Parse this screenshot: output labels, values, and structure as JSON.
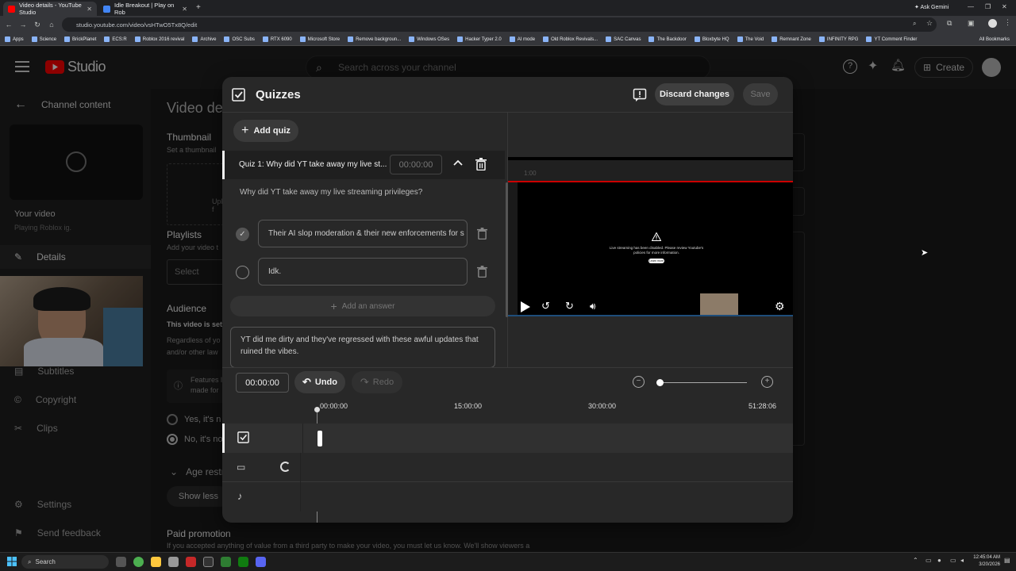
{
  "browser": {
    "tabs": [
      {
        "title": "Video details - YouTube Studio",
        "active": true
      },
      {
        "title": "Idle Breakout | Play on Rob",
        "active": false
      }
    ],
    "url": "studio.youtube.com/video/vsHTwO5Tx8Q/edit",
    "ask_label": "Ask Gemini",
    "bookmarks": [
      "Apps",
      "Science",
      "BrickPlanet",
      "ECS:R",
      "Roblox 2016 revival",
      "Archive",
      "OSC Subs",
      "RTX 6090",
      "Microsoft Store",
      "Remove backgroun...",
      "Windows OSes",
      "Hacker Typer 2.0",
      "AI mode",
      "Old Roblox Revivals...",
      "SAC Canvas",
      "The Backdoor",
      "Bloxbyte HQ",
      "The Void",
      "Remnant Zone",
      "INFINITY RPG",
      "YT Comment Finder"
    ],
    "all_bookmarks": "All Bookmarks"
  },
  "studio": {
    "logo": "Studio",
    "search_placeholder": "Search across your channel",
    "create_label": "Create"
  },
  "sidebar": {
    "back_label": "Channel content",
    "your_video": "Your video",
    "playing": "Playing Roblox ig.",
    "details": "Details",
    "items": [
      "Subtitles",
      "Copyright",
      "Clips",
      "Settings",
      "Send feedback"
    ]
  },
  "background": {
    "title": "Video de",
    "thumbnail": "Thumbnail",
    "thumbnail_sub": "Set a thumbnail",
    "upload": "Upload f",
    "playlists": "Playlists",
    "playlists_sub": "Add your video t",
    "select": "Select",
    "audience": "Audience",
    "audience_sub": "This video is set",
    "regardless": "Regardless of yo",
    "other_law": "and/or other law",
    "features": "Features l",
    "made_for": "made for",
    "yes": "Yes, it's n",
    "no": "No, it's no",
    "age": "Age restr",
    "show_less": "Show less",
    "paid": "Paid promotion",
    "paid_sub": "If you accepted anything of value from a third party to make your video, you must let us know. We'll show viewers a"
  },
  "modal": {
    "title": "Quizzes",
    "discard": "Discard changes",
    "save": "Save",
    "add_quiz": "Add quiz",
    "quiz_title": "Quiz 1: Why did YT take away my live st...",
    "quiz_time": "00:00:00",
    "question": "Why did YT take away my live streaming privileges?",
    "answers": [
      {
        "text": "Their AI slop moderation & their new enforcements for s",
        "correct": true
      },
      {
        "text": "Idk.",
        "correct": false
      }
    ],
    "add_answer": "Add an answer",
    "explanation": "YT did me dirty and they've regressed with these awful updates that ruined the vibes.",
    "player_msg": "Live streaming has been disabled. Please review Youtube's policies for more information.",
    "player_btn": "Learn more",
    "player_time": "1:00",
    "time_field": "00:00:00",
    "undo": "Undo",
    "redo": "Redo",
    "zoom_level": 0.0,
    "ruler": [
      "00:00:00",
      "15:00:00",
      "30:00:00",
      "51:28:06"
    ]
  },
  "taskbar": {
    "search": "Search",
    "time": "12:45:04 AM",
    "date": "3/20/2026"
  },
  "colors": {
    "accent": "#ff0000",
    "modal_bg": "#282828",
    "bg": "#0f0f0f"
  }
}
